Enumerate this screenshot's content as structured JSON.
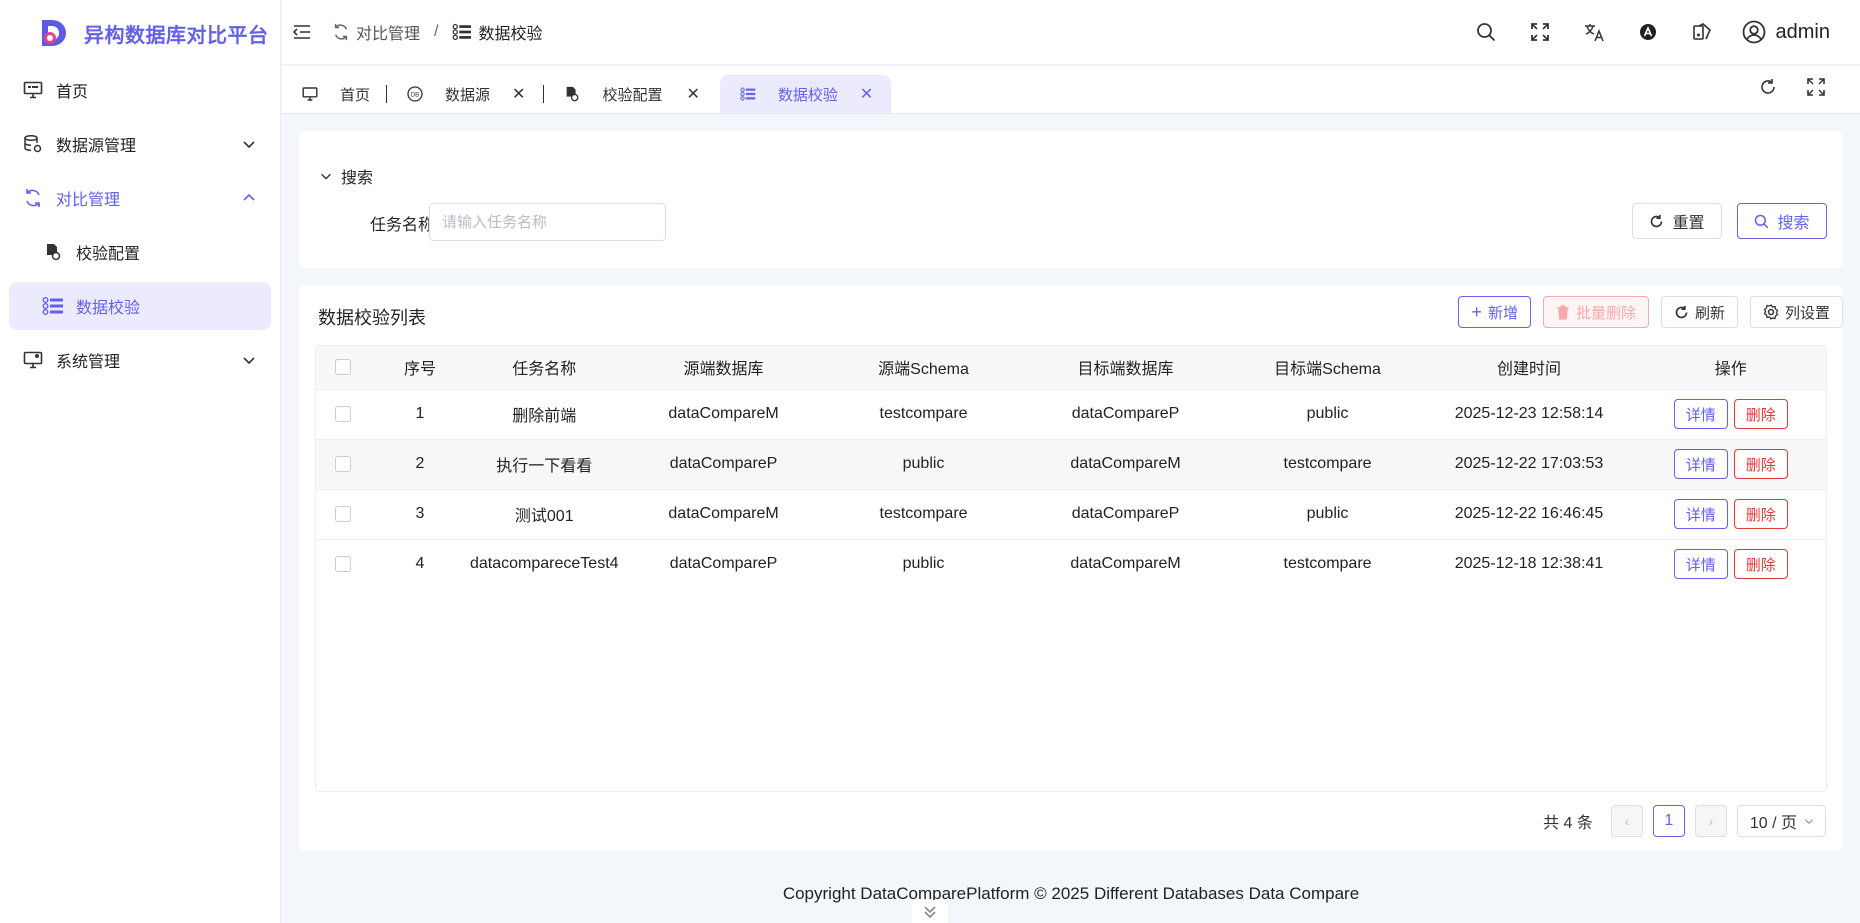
{
  "app": {
    "title": "异构数据库对比平台",
    "brand_color": "#6560e8"
  },
  "sidebar": {
    "items": [
      {
        "label": "首页",
        "icon": "monitor-icon"
      },
      {
        "label": "数据源管理",
        "icon": "database-settings-icon"
      },
      {
        "label": "对比管理",
        "icon": "compare-icon"
      },
      {
        "label": "校验配置",
        "icon": "config-file-icon"
      },
      {
        "label": "数据校验",
        "icon": "list-icon"
      },
      {
        "label": "系统管理",
        "icon": "system-settings-icon"
      }
    ]
  },
  "header": {
    "breadcrumb": [
      "对比管理",
      "数据校验"
    ],
    "breadcrumb_sep": "/",
    "username": "admin"
  },
  "tabs": [
    {
      "label": "首页"
    },
    {
      "label": "数据源"
    },
    {
      "label": "校验配置"
    },
    {
      "label": "数据校验"
    }
  ],
  "search": {
    "title": "搜索",
    "field_label": "任务名称",
    "placeholder": "请输入任务名称",
    "reset_label": "重置",
    "search_label": "搜索"
  },
  "list": {
    "title": "数据校验列表",
    "add_label": "新增",
    "batch_delete_label": "批量删除",
    "refresh_label": "刷新",
    "columns_label": "列设置",
    "columns": [
      "序号",
      "任务名称",
      "源端数据库",
      "源端Schema",
      "目标端数据库",
      "目标端Schema",
      "创建时间",
      "操作"
    ],
    "rows": [
      {
        "idx": "1",
        "name": "删除前端",
        "src_db": "dataCompareM",
        "src_schema": "testcompare",
        "dst_db": "dataCompareP",
        "dst_schema": "public",
        "created": "2025-12-23 12:58:14"
      },
      {
        "idx": "2",
        "name": "执行一下看看",
        "src_db": "dataCompareP",
        "src_schema": "public",
        "dst_db": "dataCompareM",
        "dst_schema": "testcompare",
        "created": "2025-12-22 17:03:53"
      },
      {
        "idx": "3",
        "name": "测试001",
        "src_db": "dataCompareM",
        "src_schema": "testcompare",
        "dst_db": "dataCompareP",
        "dst_schema": "public",
        "created": "2025-12-22 16:46:45"
      },
      {
        "idx": "4",
        "name": "datacompareceTest4",
        "src_db": "dataCompareP",
        "src_schema": "public",
        "dst_db": "dataCompareM",
        "dst_schema": "testcompare",
        "created": "2025-12-18 12:38:41"
      }
    ],
    "detail_label": "详情",
    "delete_label": "删除"
  },
  "pagination": {
    "total_text": "共 4 条",
    "current_page": "1",
    "page_size": "10 / 页"
  },
  "footer": {
    "text": "Copyright DataComparePlatform © 2025 Different Databases Data Compare"
  }
}
